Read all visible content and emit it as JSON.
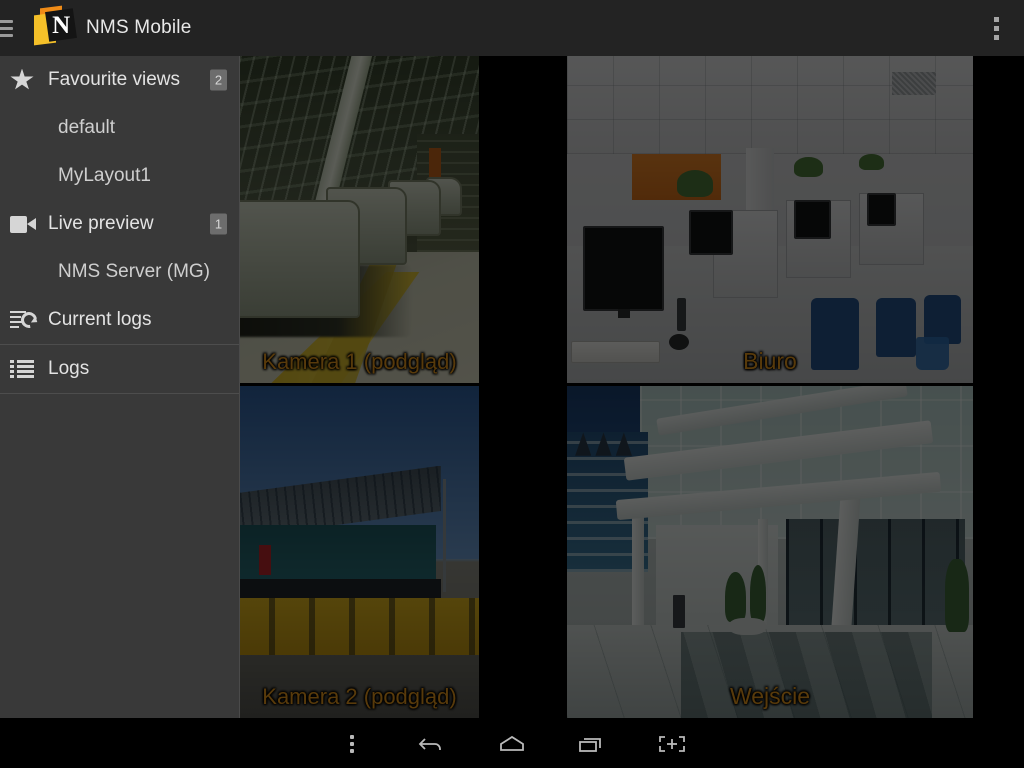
{
  "app": {
    "title": "NMS Mobile",
    "logo_letter": "N",
    "logo_colors": {
      "orange": "#ef8b17",
      "yellow": "#f5c029",
      "box": "#141414"
    }
  },
  "actionbar": {
    "menu_icon": "hamburger-icon",
    "overflow_icon": "overflow-menu-icon"
  },
  "drawer": {
    "sections": [
      {
        "id": "favourite-views",
        "label": "Favourite views",
        "icon": "star-icon",
        "badge": "2",
        "children": [
          {
            "label": "default"
          },
          {
            "label": "MyLayout1"
          }
        ]
      },
      {
        "id": "live-preview",
        "label": "Live preview",
        "icon": "video-camera-icon",
        "badge": "1",
        "children": [
          {
            "label": "NMS Server (MG)"
          }
        ]
      },
      {
        "id": "current-logs",
        "label": "Current logs",
        "icon": "sync-logs-icon",
        "badge": "",
        "children": []
      },
      {
        "id": "logs",
        "label": "Logs",
        "icon": "list-icon",
        "badge": "",
        "children": []
      }
    ]
  },
  "grid": {
    "cells": [
      {
        "id": "cell-1",
        "label": "Kamera 1 (podgląd)",
        "scene": "factory-assembly-line"
      },
      {
        "id": "cell-2",
        "label": "Biuro",
        "scene": "office-cubicles"
      },
      {
        "id": "cell-3",
        "label": "Kamera 2 (podgląd)",
        "scene": "logistics-yard"
      },
      {
        "id": "cell-4",
        "label": "Wejście",
        "scene": "glass-entrance"
      }
    ],
    "label_color": "#e79a1d"
  },
  "sysnav": {
    "buttons": [
      {
        "id": "menu",
        "icon": "overflow-menu-icon"
      },
      {
        "id": "back",
        "icon": "back-arrow-icon"
      },
      {
        "id": "home",
        "icon": "home-icon"
      },
      {
        "id": "recent",
        "icon": "recent-apps-icon"
      },
      {
        "id": "screenshot",
        "icon": "screenshot-brackets-plus-icon"
      }
    ]
  }
}
